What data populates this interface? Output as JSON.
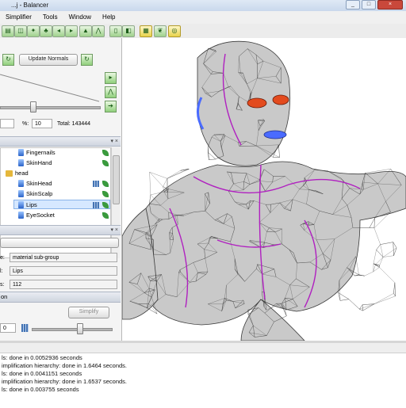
{
  "window": {
    "title": "...j - Balancer",
    "minimize": "_",
    "maximize": "□",
    "close": "×"
  },
  "menu": [
    "Simplifier",
    "Tools",
    "Window",
    "Help"
  ],
  "toolbar_icons": [
    "open-icon",
    "save-icon",
    "model-icon",
    "tree-icon",
    "arrow-left-icon",
    "arrow-right-icon",
    "undo-icon",
    "redo-icon",
    "mesh-icon",
    "tent-icon",
    "cylinder-icon",
    "cube-icon",
    "light-icon",
    "material-icon",
    "leaf-icon"
  ],
  "left_panel": {
    "update_normals_label": "Update Normals",
    "percent_label": "%:",
    "percent_value": "10",
    "total_label": "Total: 143444",
    "slider_level": 0.33,
    "tree_items": [
      {
        "label": "Fingernails",
        "indent": 1,
        "icon": "node-icon"
      },
      {
        "label": "SkinHand",
        "indent": 1,
        "icon": "node-icon"
      },
      {
        "label": "head",
        "indent": 0,
        "icon": "folder-icon"
      },
      {
        "label": "SkinHead",
        "indent": 1,
        "icon": "node-icon"
      },
      {
        "label": "SkinScalp",
        "indent": 1,
        "icon": "node-icon"
      },
      {
        "label": "Lips",
        "indent": 1,
        "icon": "node-icon",
        "selected": true
      },
      {
        "label": "EyeSocket",
        "indent": 1,
        "icon": "node-icon"
      }
    ],
    "properties": {
      "type_label": "e:",
      "type_value": "material sub-group",
      "name_label": "l:",
      "name_value": "Lips",
      "count_label": "s:",
      "count_value": "112"
    },
    "section_label": "on",
    "simplify_label": "Simplify",
    "bottom_field_value": "0",
    "bottom_slider_level": 0.6
  },
  "log": {
    "lines": [
      "ls: done in 0.0052936 seconds",
      "implification hierarchy: done in 1.6464 seconds.",
      "ls: done in 0.0041151 seconds",
      "implification hierarchy: done in 1.6537 seconds.",
      "ls: done in 0.003755 seconds"
    ]
  },
  "colors": {
    "mesh_fill": "#c9c9c9",
    "mesh_edge": "#3a3a3a",
    "seam": "#b020c0",
    "lips": "#4a6bff",
    "eyes": "#e34b1e"
  }
}
